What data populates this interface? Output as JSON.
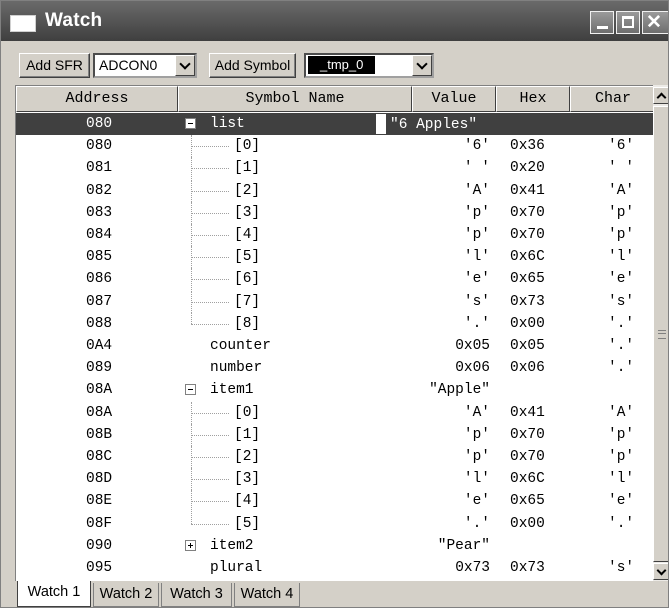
{
  "window": {
    "title": "Watch"
  },
  "toolbar": {
    "add_sfr_label": "Add SFR",
    "sfr_select_value": "ADCON0",
    "add_symbol_label": "Add Symbol",
    "symbol_select_value": "_tmp_0"
  },
  "columns": {
    "address": "Address",
    "symbol_name": "Symbol Name",
    "value": "Value",
    "hex": "Hex",
    "char": "Char"
  },
  "rows": [
    {
      "address": "080",
      "name": "list",
      "value": "\"6 Apples\"",
      "hex": "",
      "char": "",
      "level": 0,
      "expander": "minus",
      "selected": true
    },
    {
      "address": "080",
      "name": "[0]",
      "value": "'6'",
      "hex": "0x36",
      "char": "'6'",
      "level": 1
    },
    {
      "address": "081",
      "name": "[1]",
      "value": "' '",
      "hex": "0x20",
      "char": "' '",
      "level": 1
    },
    {
      "address": "082",
      "name": "[2]",
      "value": "'A'",
      "hex": "0x41",
      "char": "'A'",
      "level": 1
    },
    {
      "address": "083",
      "name": "[3]",
      "value": "'p'",
      "hex": "0x70",
      "char": "'p'",
      "level": 1
    },
    {
      "address": "084",
      "name": "[4]",
      "value": "'p'",
      "hex": "0x70",
      "char": "'p'",
      "level": 1
    },
    {
      "address": "085",
      "name": "[5]",
      "value": "'l'",
      "hex": "0x6C",
      "char": "'l'",
      "level": 1
    },
    {
      "address": "086",
      "name": "[6]",
      "value": "'e'",
      "hex": "0x65",
      "char": "'e'",
      "level": 1
    },
    {
      "address": "087",
      "name": "[7]",
      "value": "'s'",
      "hex": "0x73",
      "char": "'s'",
      "level": 1
    },
    {
      "address": "088",
      "name": "[8]",
      "value": "'.'",
      "hex": "0x00",
      "char": "'.'",
      "level": 1,
      "last": true
    },
    {
      "address": "0A4",
      "name": "counter",
      "value": "0x05",
      "hex": "0x05",
      "char": "'.'",
      "level": 0
    },
    {
      "address": "089",
      "name": "number",
      "value": "0x06",
      "hex": "0x06",
      "char": "'.'",
      "level": 0
    },
    {
      "address": "08A",
      "name": "item1",
      "value": "\"Apple\"",
      "hex": "",
      "char": "",
      "level": 0,
      "expander": "minus"
    },
    {
      "address": "08A",
      "name": "[0]",
      "value": "'A'",
      "hex": "0x41",
      "char": "'A'",
      "level": 1
    },
    {
      "address": "08B",
      "name": "[1]",
      "value": "'p'",
      "hex": "0x70",
      "char": "'p'",
      "level": 1
    },
    {
      "address": "08C",
      "name": "[2]",
      "value": "'p'",
      "hex": "0x70",
      "char": "'p'",
      "level": 1
    },
    {
      "address": "08D",
      "name": "[3]",
      "value": "'l'",
      "hex": "0x6C",
      "char": "'l'",
      "level": 1
    },
    {
      "address": "08E",
      "name": "[4]",
      "value": "'e'",
      "hex": "0x65",
      "char": "'e'",
      "level": 1
    },
    {
      "address": "08F",
      "name": "[5]",
      "value": "'.'",
      "hex": "0x00",
      "char": "'.'",
      "level": 1,
      "last": true
    },
    {
      "address": "090",
      "name": "item2",
      "value": "\"Pear\"",
      "hex": "",
      "char": "",
      "level": 0,
      "expander": "plus"
    },
    {
      "address": "095",
      "name": "plural",
      "value": "0x73",
      "hex": "0x73",
      "char": "'s'",
      "level": 0
    }
  ],
  "tabs": [
    "Watch 1",
    "Watch 2",
    "Watch 3",
    "Watch 4"
  ],
  "active_tab": "Watch 1",
  "colors": {
    "selected_row": "#404040",
    "title_bar": "#4a4a4a",
    "face": "#d4d0c8"
  }
}
